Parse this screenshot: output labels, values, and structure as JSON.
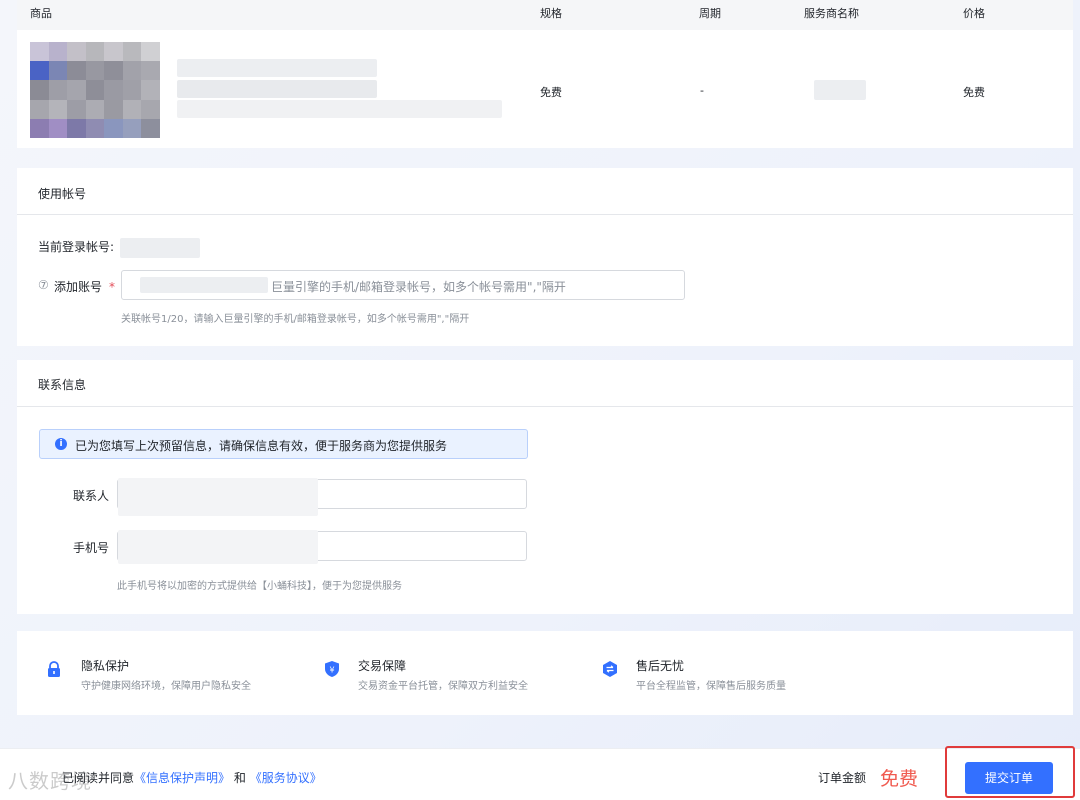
{
  "table": {
    "headers": {
      "product": "商品",
      "spec": "规格",
      "period": "周期",
      "provider": "服务商名称",
      "price": "价格"
    },
    "row": {
      "spec": "免费",
      "period": "-",
      "price": "免费"
    }
  },
  "account": {
    "title": "使用帐号",
    "current_label": "当前登录帐号:",
    "add_label": "添加账号",
    "add_placeholder": "巨量引擎的手机/邮箱登录帐号，如多个帐号需用\",\"隔开",
    "add_hint": "关联帐号1/20，请输入巨量引擎的手机/邮箱登录帐号，如多个帐号需用\",\"隔开",
    "help_glyph": "⑦",
    "required_mark": "*"
  },
  "contact": {
    "title": "联系信息",
    "notice": "已为您填写上次预留信息，请确保信息有效，便于服务商为您提供服务",
    "contact_label": "联系人",
    "phone_label": "手机号",
    "phone_hint": "此手机号将以加密的方式提供给【小蛹科技】，便于为您提供服务"
  },
  "guarantees": [
    {
      "icon": "lock-icon",
      "title": "隐私保护",
      "desc": "守护健康网络环境，保障用户隐私安全"
    },
    {
      "icon": "shield-yen-icon",
      "title": "交易保障",
      "desc": "交易资金平台托管，保障双方利益安全"
    },
    {
      "icon": "exchange-icon",
      "title": "售后无忧",
      "desc": "平台全程监管，保障售后服务质量"
    }
  ],
  "footer": {
    "agree_prefix": "已阅读并同意",
    "privacy_link": "《信息保护声明》",
    "and": "和",
    "service_link": "《服务协议》",
    "amount_label": "订单金额",
    "amount": "免费",
    "submit": "提交订单",
    "watermark": "八数跨境"
  },
  "colors": {
    "accent": "#3370ff",
    "price": "#f05a4f",
    "highlight_frame": "#e03b3b"
  }
}
